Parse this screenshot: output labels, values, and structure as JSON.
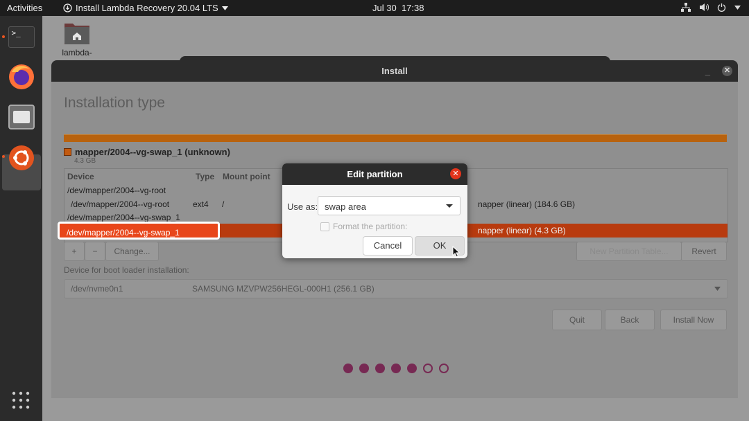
{
  "topbar": {
    "activities": "Activities",
    "app_menu": "Install Lambda Recovery 20.04 LTS",
    "clock_date": "Jul 30",
    "clock_time": "17:38",
    "tray_icons": [
      "network-icon",
      "volume-icon",
      "power-icon"
    ]
  },
  "dock": {
    "items": [
      "terminal-icon",
      "firefox-icon",
      "files-icon",
      "ubiquity-installer-icon"
    ],
    "app_grid_icon": "show-applications-icon"
  },
  "desktop": {
    "home_folder_label": "lambda-"
  },
  "window": {
    "title": "Install",
    "heading": "Installation type",
    "partition_legend": "mapper/2004--vg-swap_1 (unknown)",
    "partition_size": "4.3 GB",
    "columns": [
      "Device",
      "Type",
      "Mount point"
    ],
    "rows": [
      {
        "device": "/dev/mapper/2004--vg-root",
        "type": "",
        "mount": "",
        "desc": ""
      },
      {
        "device": "/dev/mapper/2004--vg-root",
        "type": "ext4",
        "mount": "/",
        "desc": "napper (linear) (184.6 GB)"
      },
      {
        "device": "/dev/mapper/2004--vg-swap_1",
        "type": "",
        "mount": "",
        "desc": ""
      },
      {
        "device": "/dev/mapper/2004--vg-swap_1",
        "type": "",
        "mount": "",
        "desc": "napper (linear) (4.3 GB)"
      }
    ],
    "add_label": "+",
    "remove_label": "−",
    "change_label": "Change...",
    "new_table_label": "New Partition Table...",
    "revert_label": "Revert",
    "boot_loader_label": "Device for boot loader installation:",
    "boot_device": "/dev/nvme0n1",
    "boot_device_desc": "SAMSUNG MZVPW256HEGL-000H1 (256.1 GB)",
    "quit_label": "Quit",
    "back_label": "Back",
    "install_label": "Install Now",
    "progress": {
      "filled": 5,
      "total": 7
    },
    "colors": {
      "accent": "#e95420",
      "dot": "#772953",
      "selected_row": "#e8461a"
    }
  },
  "dialog": {
    "title": "Edit partition",
    "use_as_label": "Use as:",
    "use_as_value": "swap area",
    "format_label": "Format the partition:",
    "format_checked": false,
    "cancel_label": "Cancel",
    "ok_label": "OK"
  }
}
